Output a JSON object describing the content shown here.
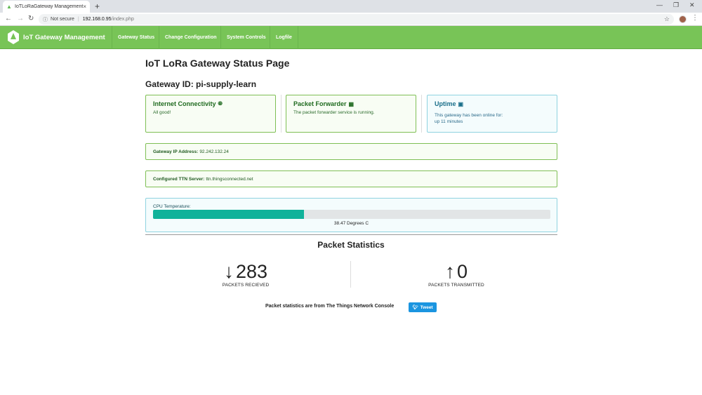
{
  "browser": {
    "tab_title": "IoTLoRaGateway Management",
    "tab_close": "×",
    "new_tab": "+",
    "security": "Not secure",
    "url_host": "192.168.0.95",
    "url_path": "/index.php",
    "win_min": "—",
    "win_max": "❐",
    "win_close": "✕"
  },
  "navbar": {
    "brand": "IoT Gateway Management",
    "items": [
      "Gateway Status",
      "Change Configuration",
      "System Controls",
      "Logfile"
    ],
    "color": "#78c457"
  },
  "page": {
    "title": "IoT LoRa Gateway Status Page",
    "gateway_id": "Gateway ID: pi-supply-learn"
  },
  "cards": {
    "internet": {
      "title": "Internet Connectivity",
      "text": "All good!",
      "icon": "globe-icon"
    },
    "forwarder": {
      "title": "Packet Forwarder",
      "text": "The packet forwarder service is running.",
      "icon": "chip-icon"
    },
    "uptime": {
      "title": "Uptime",
      "text1": "This gateway has been online for:",
      "text2": "up 11 minutes",
      "icon": "calendar-icon"
    }
  },
  "info": {
    "ip_label": "Gateway IP Address:",
    "ip_value": "92.242.132.24",
    "ttn_label": "Configured TTN Server:",
    "ttn_value": "ttn.thingsconnected.net"
  },
  "cpu": {
    "label": "CPU Temperature:",
    "value_text": "38.47 Degrees C",
    "fill_fraction": 0.38,
    "bar_color": "#10b29a"
  },
  "stats": {
    "title": "Packet Statistics",
    "received": {
      "value": "283",
      "caption": "PACKETS RECIEVED",
      "arrow": "🡓"
    },
    "transmitted": {
      "value": "0",
      "caption": "PACKETS TRANSMITTED",
      "arrow": "🡑"
    },
    "note": "Packet statistics are from The Things Network Console",
    "tweet": "Tweet"
  }
}
